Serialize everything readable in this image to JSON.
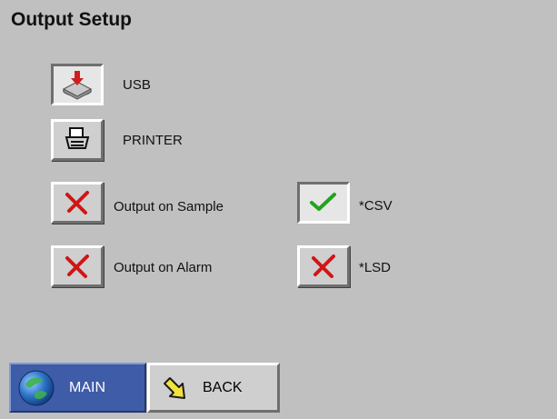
{
  "page": {
    "title": "Output Setup"
  },
  "devices": {
    "usb": {
      "label": "USB",
      "icon": "usb-drive-icon",
      "selected": true
    },
    "printer": {
      "label": "PRINTER",
      "icon": "printer-icon",
      "selected": false
    }
  },
  "options": {
    "output_on_sample": {
      "label": "Output on Sample",
      "state": "off",
      "icon": "x-icon"
    },
    "output_on_alarm": {
      "label": "Output on Alarm",
      "state": "off",
      "icon": "x-icon"
    },
    "csv": {
      "label": "*CSV",
      "state": "on",
      "icon": "check-icon"
    },
    "lsd": {
      "label": "*LSD",
      "state": "off",
      "icon": "x-icon"
    }
  },
  "nav": {
    "main_label": "MAIN",
    "back_label": "BACK"
  },
  "colors": {
    "background": "#c0c0c0",
    "x_red": "#d21414",
    "check_green": "#22a31f",
    "main_blue": "#3e5ca8"
  }
}
